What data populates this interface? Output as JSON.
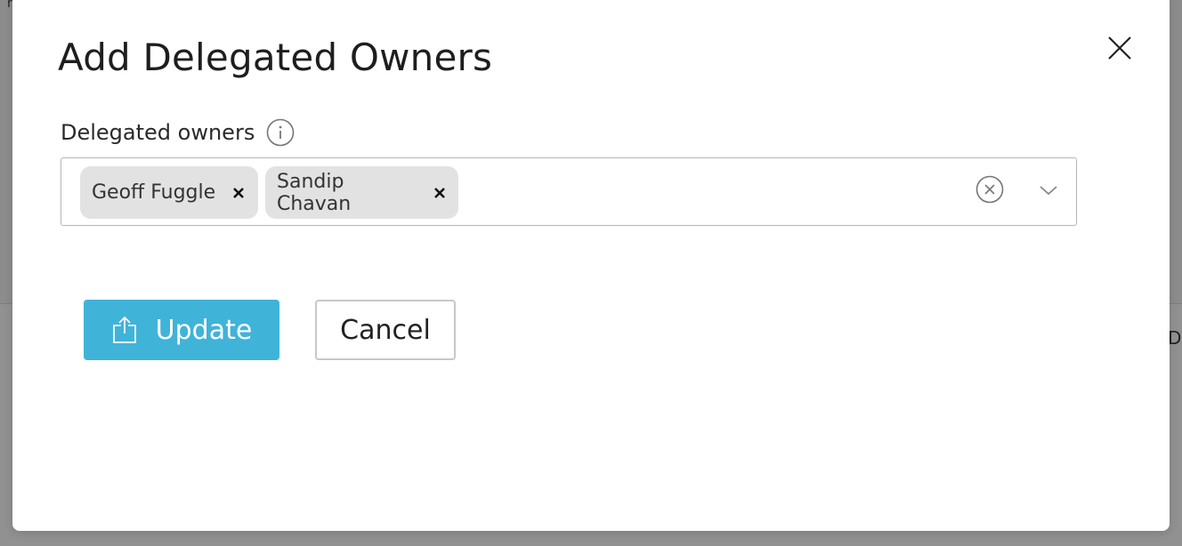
{
  "background": {
    "glyph_top": "r",
    "glyph_right": "D"
  },
  "dialog": {
    "title": "Add Delegated Owners",
    "close_icon": "close-icon"
  },
  "delegated_owners": {
    "label": "Delegated owners",
    "info_icon": "info-icon",
    "selected": [
      {
        "name": "Geoff Fuggle",
        "remove_icon": "x-icon"
      },
      {
        "name": "Sandip Chavan",
        "remove_icon": "x-icon"
      }
    ],
    "clear_icon": "clear-circle-icon",
    "dropdown_icon": "chevron-down-icon"
  },
  "actions": {
    "update_label": "Update",
    "update_icon": "share-upload-icon",
    "cancel_label": "Cancel"
  },
  "colors": {
    "primary": "#40b3d9",
    "chip_bg": "#e2e2e2",
    "overlay": "#8f8f8f"
  }
}
